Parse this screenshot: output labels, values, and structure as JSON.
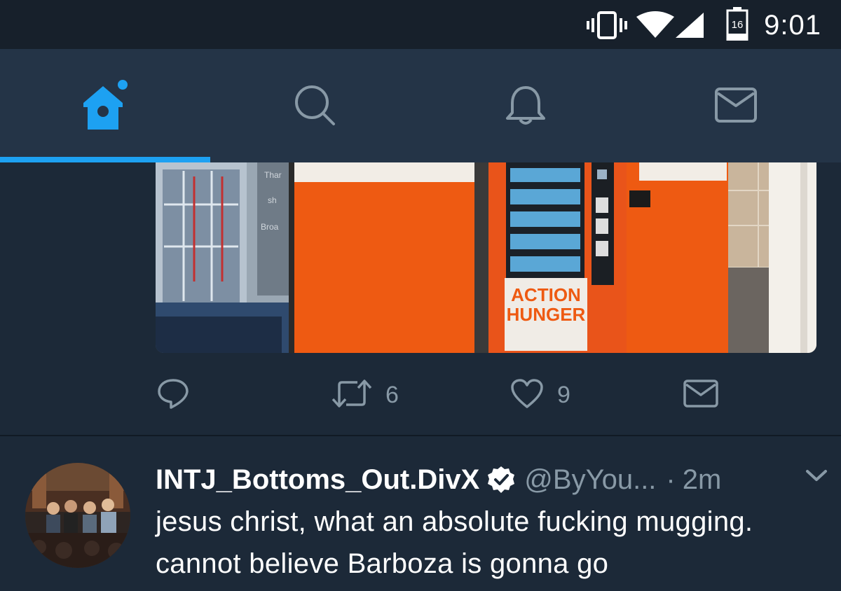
{
  "status_bar": {
    "battery_level": "16",
    "time": "9:01",
    "icons": [
      "vibrate-icon",
      "wifi-icon",
      "cell-signal-icon",
      "battery-icon"
    ]
  },
  "nav_tabs": [
    {
      "name": "home",
      "icon": "home-icon",
      "active": true,
      "has_notification_dot": true
    },
    {
      "name": "search",
      "icon": "search-icon",
      "active": false
    },
    {
      "name": "notifications",
      "icon": "bell-icon",
      "active": false
    },
    {
      "name": "messages",
      "icon": "envelope-icon",
      "active": false
    }
  ],
  "tweet1": {
    "image_sign_text": [
      "ACTION",
      "HUNGER"
    ],
    "image_background_text": [
      "Thar",
      "sh",
      "Broa"
    ],
    "actions": {
      "reply_count": "",
      "retweet_count": "6",
      "like_count": "9"
    }
  },
  "tweet2": {
    "display_name": "INTJ_Bottoms_Out.DivX",
    "verified": true,
    "handle": "@ByYou...",
    "separator": "·",
    "time": "2m",
    "text": "jesus christ, what an absolute fucking mugging. cannot believe Barboza is gonna go"
  },
  "colors": {
    "accent": "#1da1f2",
    "background": "#1c2938",
    "navbar": "#243447",
    "statusbar": "#17202b",
    "secondary_text": "#8899a6"
  }
}
